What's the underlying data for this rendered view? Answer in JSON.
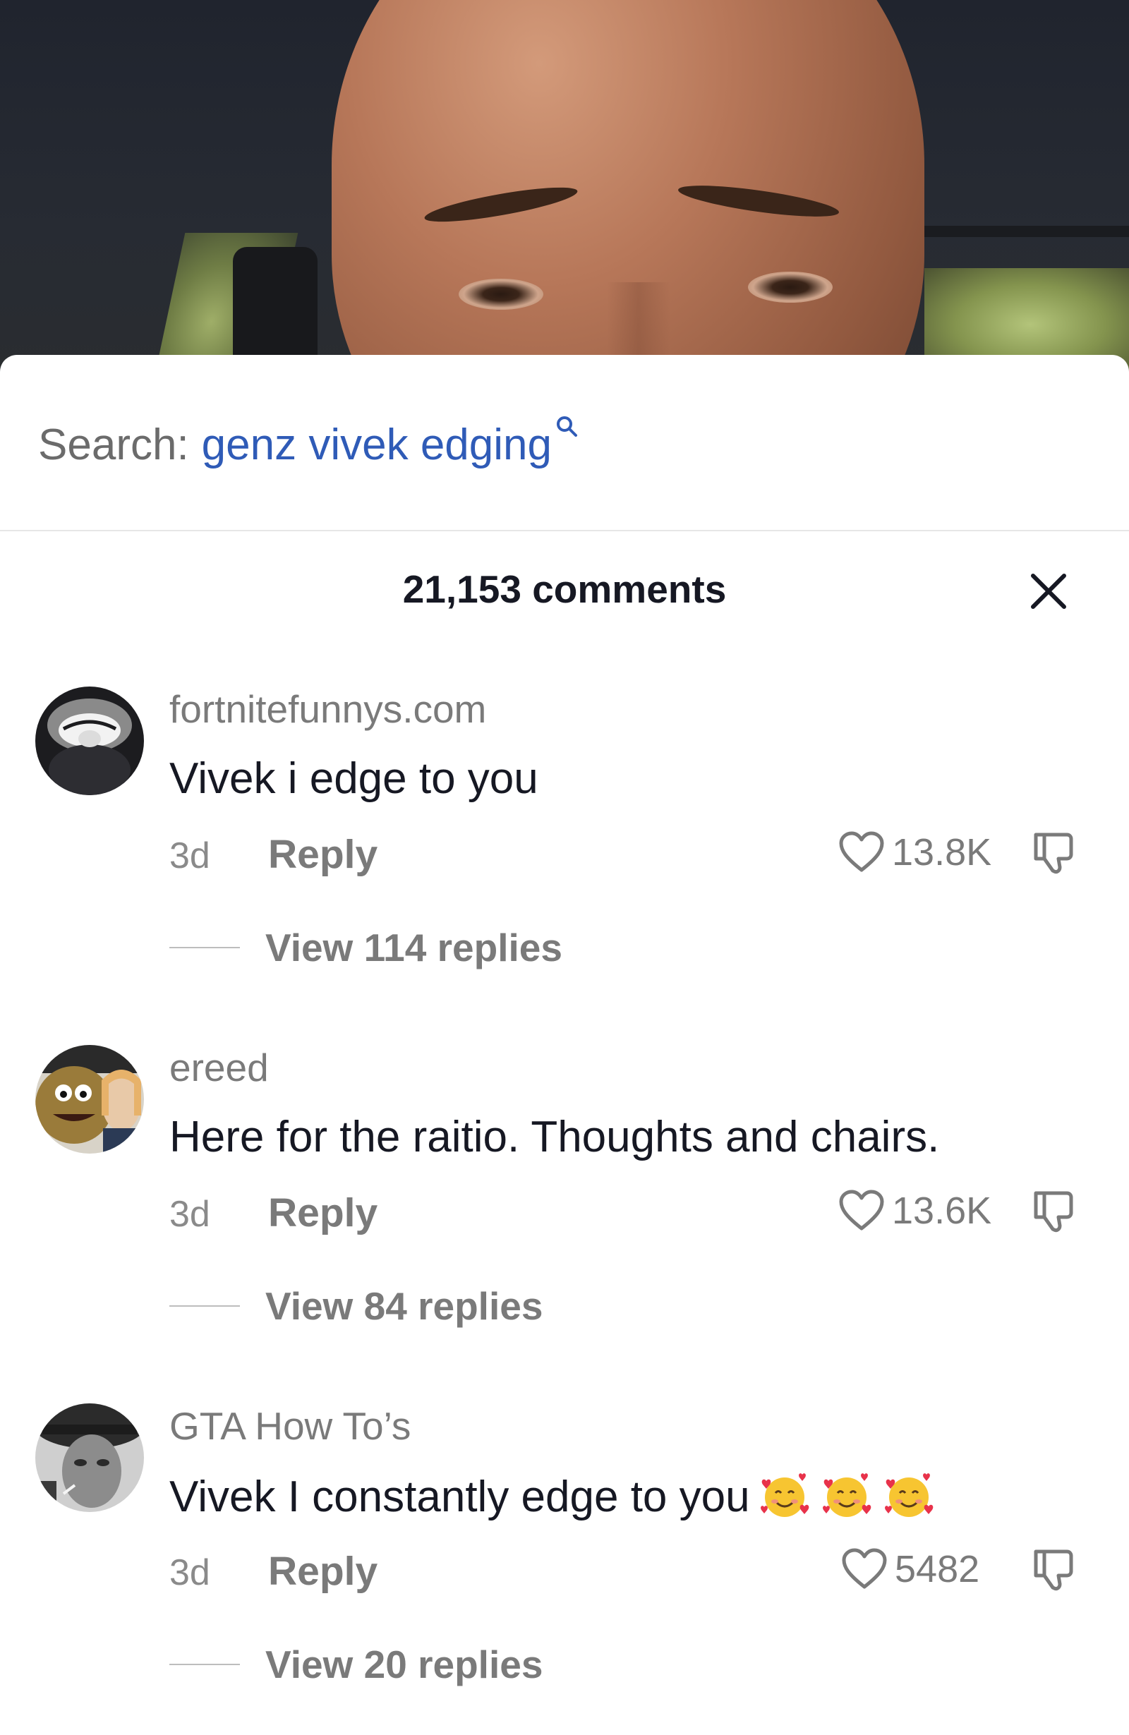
{
  "search": {
    "prefix": "Search:",
    "query": "genz vivek edging"
  },
  "comments_header": {
    "count": "21,153 comments"
  },
  "comments": [
    {
      "username": "fortnitefunnys.com",
      "text": "Vivek i edge to you",
      "time": "3d",
      "reply_label": "Reply",
      "likes": "13.8K",
      "view_replies": "View 114 replies"
    },
    {
      "username": "ereed",
      "text": "Here for the raitio. Thoughts and chairs.",
      "time": "3d",
      "reply_label": "Reply",
      "likes": "13.6K",
      "view_replies": "View 84 replies"
    },
    {
      "username": "GTA How To’s",
      "text": "Vivek I constantly edge to you",
      "text_emojis": [
        "smiling-face-with-hearts",
        "smiling-face-with-hearts",
        "smiling-face-with-hearts"
      ],
      "time": "3d",
      "reply_label": "Reply",
      "likes": "5482",
      "view_replies": "View 20 replies"
    }
  ],
  "icons": {
    "search": "search-icon",
    "close": "close-icon",
    "like": "heart-icon",
    "dislike": "dislike-icon"
  },
  "colors": {
    "search_link": "#2f5bb7",
    "secondary_text": "#7a7a7a",
    "primary_text": "#161823"
  }
}
